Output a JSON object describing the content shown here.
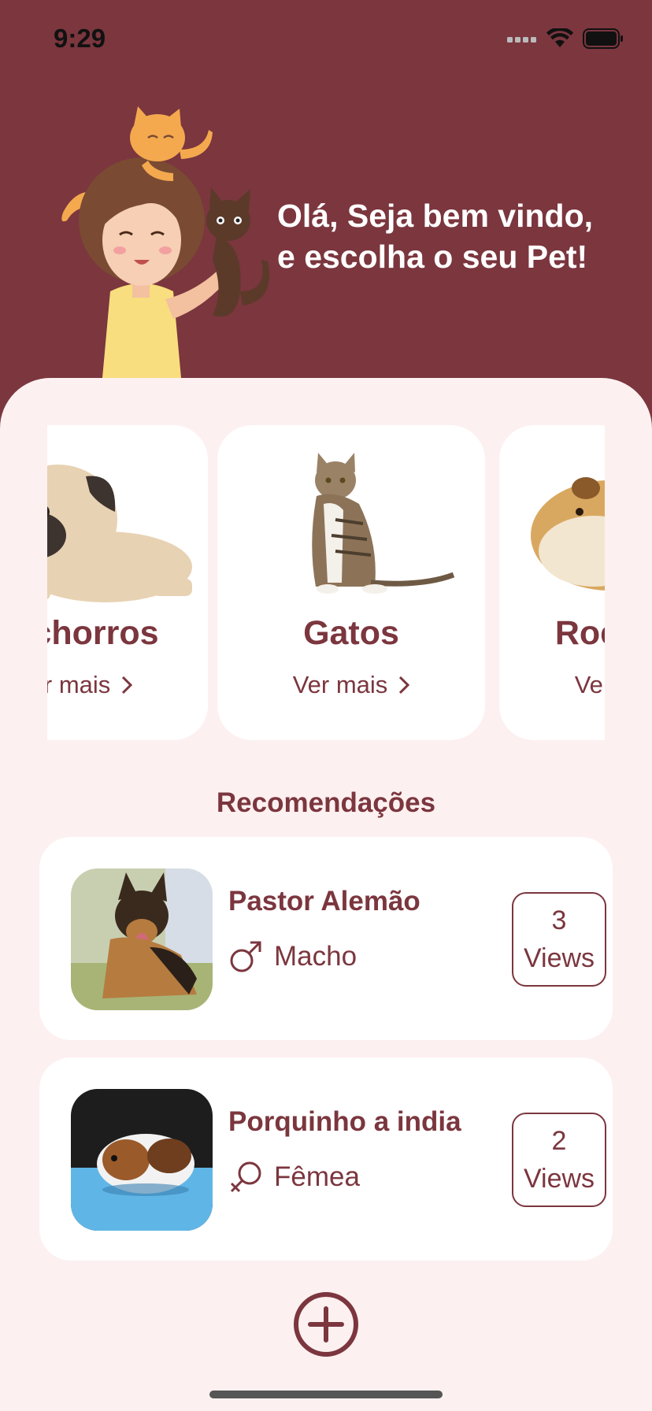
{
  "status_bar": {
    "time": "9:29",
    "icons": [
      "signal-icon",
      "wifi-icon",
      "battery-icon"
    ]
  },
  "header": {
    "welcome_line1": "Olá, Seja bem vindo,",
    "welcome_line2": "e escolha o seu Pet!",
    "illustration": "girl-with-cats-illustration"
  },
  "categories": [
    {
      "title": "Cachorros",
      "more_label": "Ver mais",
      "image": "pug-photo"
    },
    {
      "title": "Gatos",
      "more_label": "Ver mais",
      "image": "cat-photo"
    },
    {
      "title": "Roedores",
      "more_label": "Ver mais",
      "image": "guinea-pig-photo"
    }
  ],
  "recommendations": {
    "title": "Recomendações",
    "items": [
      {
        "name": "Pastor Alemão",
        "gender": "Macho",
        "gender_icon": "male-icon",
        "views_count": "3",
        "views_label": "Views",
        "image": "german-shepherd-photo"
      },
      {
        "name": "Porquinho a india",
        "gender": "Fêmea",
        "gender_icon": "female-icon",
        "views_count": "2",
        "views_label": "Views",
        "image": "guinea-pig-photo"
      }
    ]
  },
  "actions": {
    "add_icon": "plus-circle-icon"
  },
  "colors": {
    "primary": "#7b363e",
    "background": "#fdf0f0",
    "card": "#ffffff"
  }
}
